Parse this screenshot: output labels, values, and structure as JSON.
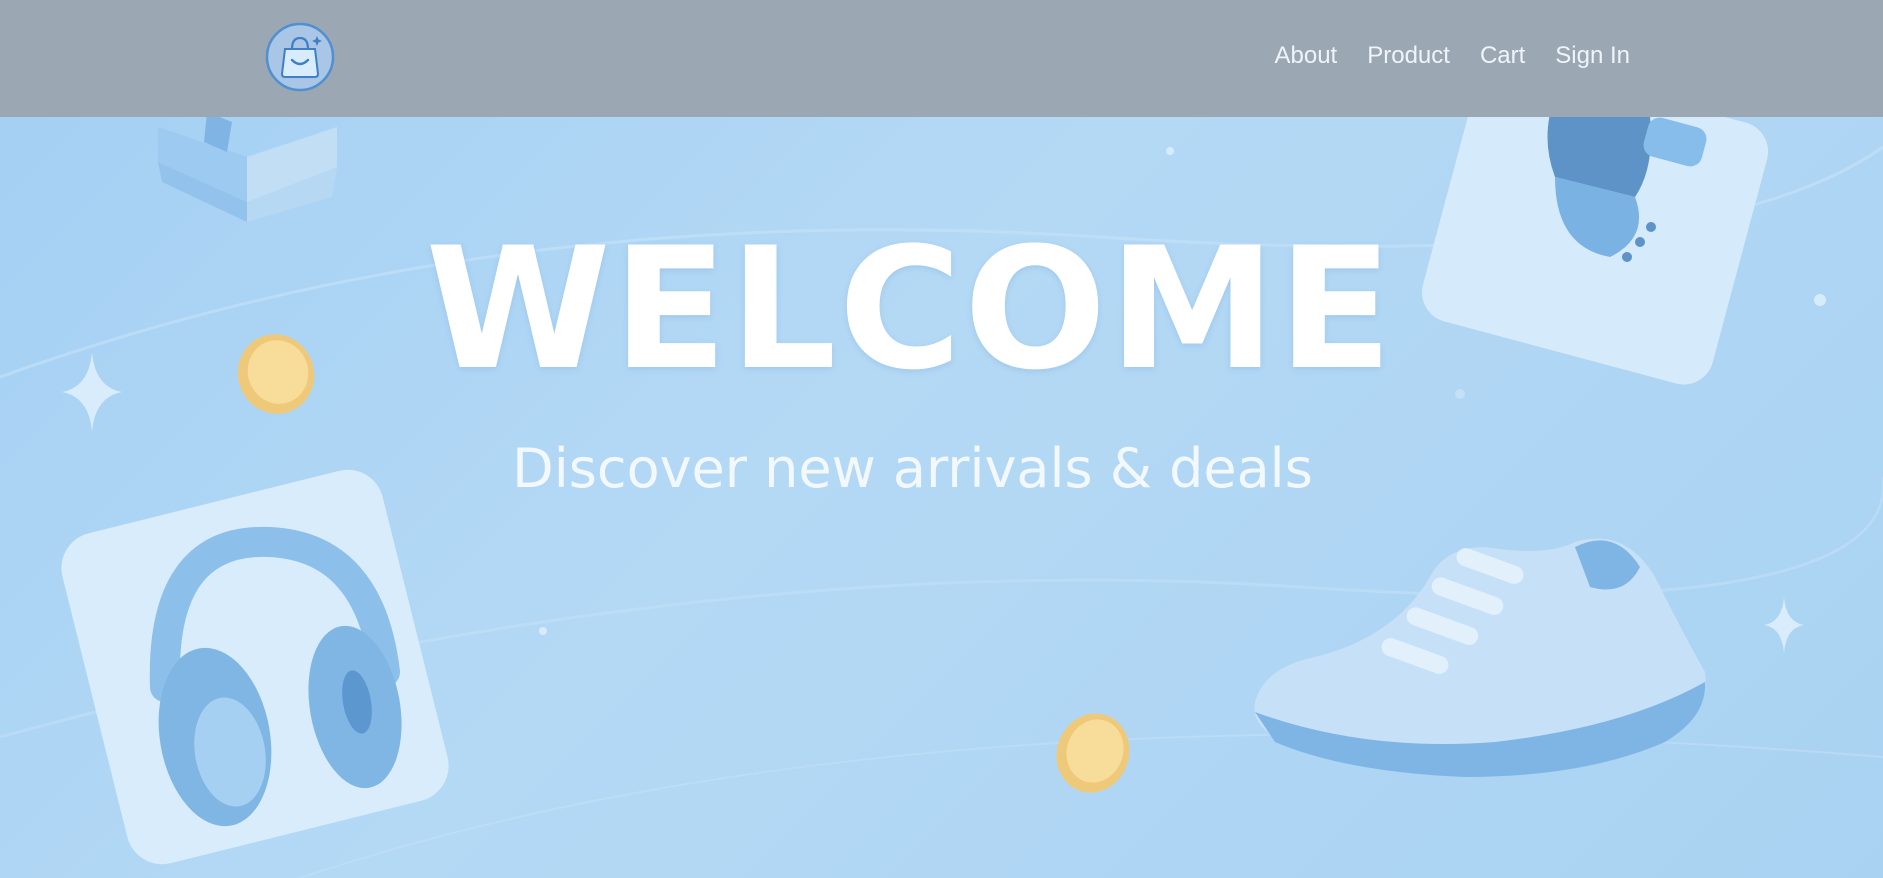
{
  "navbar": {
    "logo_icon": "shopping-bag-icon",
    "links": [
      {
        "label": "About"
      },
      {
        "label": "Product"
      },
      {
        "label": "Cart"
      },
      {
        "label": "Sign In"
      }
    ]
  },
  "hero": {
    "title": "WELCOME",
    "subtitle": "Discover new arrivals & deals",
    "decorations": [
      "box-icon",
      "smartwatch-icon",
      "coin-icon",
      "sparkle-icon",
      "headphones-icon",
      "sneaker-icon"
    ]
  },
  "colors": {
    "navbar_bg": "#9ba7b3",
    "hero_bg": "#a9d2f2",
    "accent_blue": "#6fb0e6",
    "coin_gold": "#f6d98e"
  }
}
